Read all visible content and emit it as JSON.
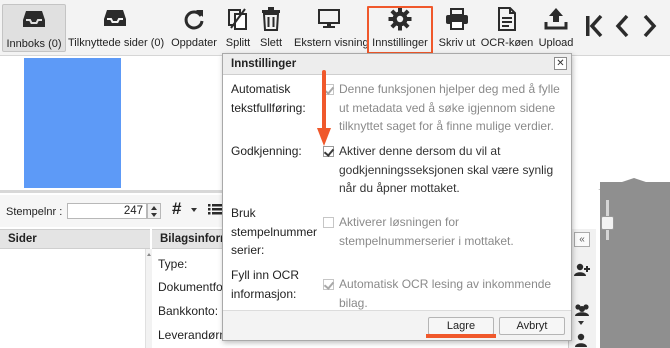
{
  "toolbar": {
    "items": [
      {
        "label": "Innboks (0)",
        "icon": "inbox-icon"
      },
      {
        "label": "Tilknyttede sider (0)",
        "icon": "inbox-icon"
      },
      {
        "label": "Oppdater",
        "icon": "refresh-icon"
      },
      {
        "label": "Splitt",
        "icon": "split-icon"
      },
      {
        "label": "Slett",
        "icon": "trash-icon"
      },
      {
        "label": "Ekstern visning",
        "icon": "monitor-icon"
      },
      {
        "label": "Innstillinger",
        "icon": "gear-icon"
      },
      {
        "label": "Skriv ut",
        "icon": "printer-icon"
      },
      {
        "label": "OCR-køen",
        "icon": "document-icon"
      },
      {
        "label": "Upload",
        "icon": "upload-icon"
      }
    ],
    "nav_icons": [
      "first-page-icon",
      "previous-icon",
      "next-icon"
    ],
    "active_item": "Innboks (0)",
    "highlighted_item": "Innstillinger"
  },
  "left": {
    "stempel_label": "Stempelnr :",
    "stempel_value": "247",
    "sider_header": "Sider",
    "bilag_header": "Bilagsinformasjon",
    "bilag_fields": [
      "Type:",
      "Dokumentformat:",
      "Bankkonto:",
      "Leverandørnr:"
    ]
  },
  "dialog": {
    "title": "Innstillinger",
    "rows": [
      {
        "label": "Automatisk tekstfullføring:",
        "checked": true,
        "disabled": true,
        "description": "Denne funksjonen hjelper deg med å fylle ut metadata ved å søke igjennom sidene tilknyttet saget for å finne mulige verdier."
      },
      {
        "label": "Godkjenning:",
        "checked": true,
        "disabled": false,
        "description": "Aktiver denne dersom du vil at godkjenningsseksjonen skal være synlig når du åpner mottaket."
      },
      {
        "label": "Bruk stempelnummer serier:",
        "checked": false,
        "disabled": true,
        "description": "Aktiverer løsningen for stempelnummerserier i mottaket."
      },
      {
        "label": "Fyll inn OCR informasjon:",
        "checked": true,
        "disabled": true,
        "description": "Automatisk OCR lesing av inkommende bilag."
      }
    ],
    "save_label": "Lagre",
    "cancel_label": "Avbryt"
  },
  "colors": {
    "highlight": "#f0582b",
    "preview": "#5d9af7",
    "icon": "#2b2b2b"
  }
}
